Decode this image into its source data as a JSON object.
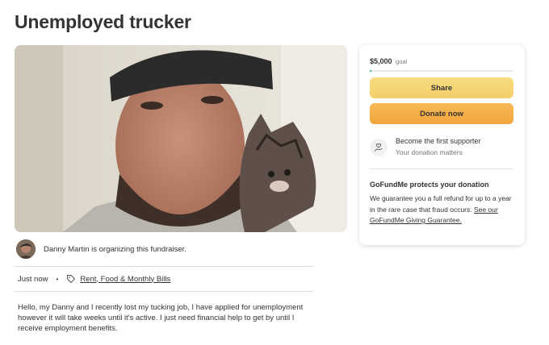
{
  "campaign": {
    "title": "Unemployed trucker"
  },
  "organizer": {
    "text": "Danny Martin is organizing this fundraiser."
  },
  "meta": {
    "time": "Just now",
    "separator": "•",
    "category": "Rent, Food & Monthly Bills"
  },
  "story": {
    "text": "Hello, my Danny and I recently lost my tucking job, I have applied for unemployment however it will take weeks until it's active. I just need financial help to get by until I receive employment benefits."
  },
  "donation_card": {
    "goal_amount": "$5,000",
    "goal_label": "goal",
    "progress_fraction": 0.01,
    "share_label": "Share",
    "donate_label": "Donate now",
    "supporter_title": "Become the first supporter",
    "supporter_subtitle": "Your donation matters",
    "protect_title": "GoFundMe protects your donation",
    "protect_body": "We guarantee you a full refund for up to a year in the rare case that fraud occurs.",
    "protect_link": "See our GoFundMe Giving Guarantee."
  },
  "colors": {
    "share_button": "#f4cf67",
    "donate_button": "#f2a43c",
    "progress": "#02a95c",
    "text": "#333333"
  },
  "icons": {
    "category": "tag-icon",
    "supporter": "hand-heart-icon"
  }
}
